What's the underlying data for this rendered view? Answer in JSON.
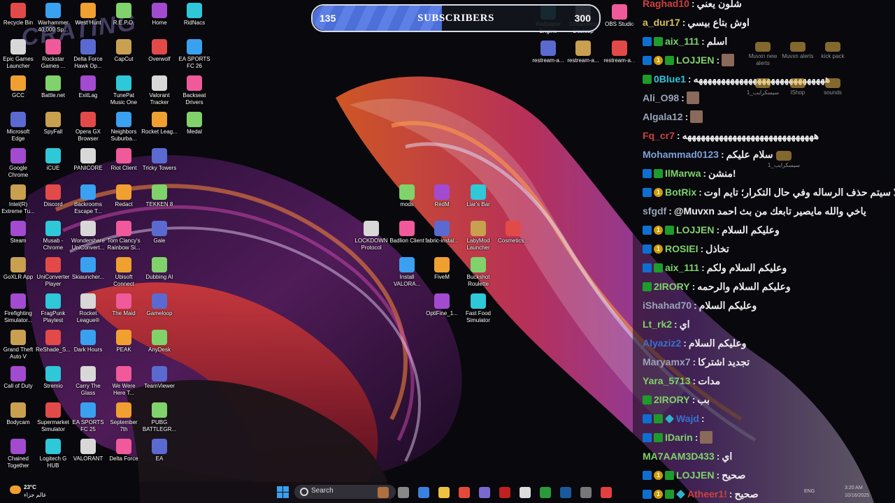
{
  "watermark_text": "CRATING",
  "subscriber_goal": {
    "current": "135",
    "label": "SUBSCRIBERS",
    "goal": "300",
    "progress": 0.45
  },
  "desktop_icons": [
    "Recycle Bin",
    "Warhammer 40,000 Sp...",
    "West Hunt",
    "R.E.P.O.",
    "Home",
    "RidNacs",
    "Epic Games Launcher",
    "Rockstar Games ...",
    "Delta Force Hawk Op...",
    "CapCut",
    "Overwolf",
    "EA SPORTS FC 26",
    "GCC",
    "Battle.net",
    "ExitLag",
    "TunePat Music One",
    "Valorant Tracker",
    "Backseat Drivers",
    "Microsoft Edge",
    "SpyFall",
    "Opera GX Browser",
    "Neighbors Suburba...",
    "Rocket Leag...",
    "Medal",
    "Google Chrome",
    "iCUE",
    "PANICORE",
    "Riot Client",
    "Tricky Towers",
    "Intel(R) Extreme Tu...",
    "Discord",
    "Backrooms Escape T...",
    "Redact",
    "TEKKEN 8",
    "Steam",
    "Musab - Chrome",
    "Wondershare UniConvert...",
    "Tom Clancy's Rainbow Si...",
    "Gale",
    "GoXLR App",
    "UniConverter Player",
    "Skiauncher...",
    "Ubisoft Connect",
    "Dubbing AI",
    "Firefighting Simulator...",
    "FragPunk Playtest",
    "Rocket League®",
    "The Maid",
    "Gameloop",
    "Grand Theft Auto V",
    "ReShade_S...",
    "Dark Hours",
    "PEAK",
    "AnyDesk",
    "Call of Duty",
    "Stremio",
    "Carry The Glass",
    "We Were Here T...",
    "TeamViewer",
    "Bodycam",
    "Supermarket Simulator",
    "EA SPORTS FC 25",
    "September 7th",
    "PUBG BATTLEGR...",
    "Chained Together",
    "Logitech G HUB",
    "VALORANT",
    "Delta Force",
    "EA"
  ],
  "center_icons": [
    "mods",
    "RedM",
    "Liar's Bar",
    "LOCKDOWN Protocol",
    "Badlion Client",
    "fabric-instal...",
    "LabyMod Launcher",
    "Cosmetics...",
    "Install VALORA...",
    "FiveM",
    "Buckshot Roulette",
    "OptiFine_1...",
    "Fast Food Simulator"
  ],
  "top_right_icons": [
    "Wallpaper Engine",
    "Streamlabs Desktop",
    "OBS Studio",
    "restream-a...",
    "restream-a...",
    "restream-a..."
  ],
  "folder_icons": [
    "Muvxn new alerts",
    "Muvxn alerts",
    "kick pack",
    "سيسكرايب_1",
    "lShop",
    "sounds",
    "سيسكرايب_1"
  ],
  "chat": [
    {
      "user": "Raghad10",
      "color": "#d04040",
      "text": "شلون يعني",
      "badges": []
    },
    {
      "user": "a_dur17",
      "color": "#d8c25a",
      "text": "اوش بتاع بيسي",
      "badges": []
    },
    {
      "user": "aix_111",
      "color": "#7fd36a",
      "text": "اسلم",
      "badges": [
        "mod",
        "vip"
      ]
    },
    {
      "user": "LOJJEN",
      "color": "#7fd36a",
      "text": "",
      "badges": [
        "mod",
        "sub",
        "vip"
      ],
      "avatar": true
    },
    {
      "user": "0Blue1",
      "color": "#2ec8d8",
      "text": "هههههههههههههههههههههههههههههه",
      "badges": [
        "vip"
      ]
    },
    {
      "user": "Ali_O98",
      "color": "#9aa4b8",
      "text": "",
      "badges": [],
      "avatar": true
    },
    {
      "user": "Algala12",
      "color": "#9aa4b8",
      "text": "",
      "badges": [],
      "avatar": true
    },
    {
      "user": "Fq_cr7",
      "color": "#d04040",
      "text": "هههههههههههههههههههههههههههههه",
      "badges": []
    },
    {
      "user": "Mohammad0123",
      "color": "#7fa0d8",
      "text": "سلام عليكم",
      "badges": []
    },
    {
      "user": "IlMarwa",
      "color": "#7fd36a",
      "text": "منشن!",
      "badges": [
        "mod",
        "vip"
      ]
    },
    {
      "user": "BotRix",
      "color": "#7fd36a",
      "text": "ره والا سيتم حذف الرساله وفي حال التكرار؛ تايم اوت",
      "badges": [
        "mod",
        "sub"
      ]
    },
    {
      "user": "sfgdf",
      "color": "#9aa4b8",
      "text": "@Muvxn ياخي والله مايصير تابعك من بث احمد",
      "badges": []
    },
    {
      "user": "LOJJEN",
      "color": "#7fd36a",
      "text": "وعليكم السلام",
      "badges": [
        "mod",
        "sub",
        "vip"
      ]
    },
    {
      "user": "ROSIEI",
      "color": "#7fd36a",
      "text": "تخاذل",
      "badges": [
        "mod",
        "sub"
      ]
    },
    {
      "user": "aix_111",
      "color": "#7fd36a",
      "text": "وعليكم السلام ولكم",
      "badges": [
        "mod",
        "vip"
      ]
    },
    {
      "user": "2IRORY",
      "color": "#7fd36a",
      "text": "وعليكم السلام والرحمه",
      "badges": [
        "vip"
      ]
    },
    {
      "user": "iShahad70",
      "color": "#9aa4b8",
      "text": "وعليكم السلام",
      "badges": []
    },
    {
      "user": "Lt_rk2",
      "color": "#7fd36a",
      "text": "اي",
      "badges": []
    },
    {
      "user": "Alyaziz2",
      "color": "#3a6fd0",
      "text": "وعليكم السلام",
      "badges": []
    },
    {
      "user": "Maryamx7",
      "color": "#9aa4b8",
      "text": "تجديد اشتركا",
      "badges": []
    },
    {
      "user": "Yara_5713",
      "color": "#7fd36a",
      "text": "مدات",
      "badges": []
    },
    {
      "user": "2IRORY",
      "color": "#7fd36a",
      "text": "بب",
      "badges": [
        "vip"
      ]
    },
    {
      "user": "Wajd",
      "color": "#3a6fd0",
      "text": "",
      "badges": [
        "mod",
        "vip",
        "gem"
      ]
    },
    {
      "user": "IDarin",
      "color": "#7fd36a",
      "text": "",
      "badges": [
        "mod",
        "vip"
      ],
      "avatar": true
    },
    {
      "user": "MA7AAM3D433",
      "color": "#7fd36a",
      "text": "اي",
      "badges": []
    },
    {
      "user": "LOJJEN",
      "color": "#7fd36a",
      "text": "صحيح",
      "badges": [
        "mod",
        "sub",
        "vip"
      ]
    },
    {
      "user": "Atheer1!",
      "color": "#d04040",
      "text": "صحيح",
      "badges": [
        "mod",
        "sub",
        "vip",
        "gem"
      ]
    }
  ],
  "taskbar": {
    "weather_temp": "23°C",
    "weather_desc": "غالم جزاء",
    "search_placeholder": "Search",
    "lang": "ENG",
    "time": "3:20 AM",
    "date": "10/16/2025"
  }
}
